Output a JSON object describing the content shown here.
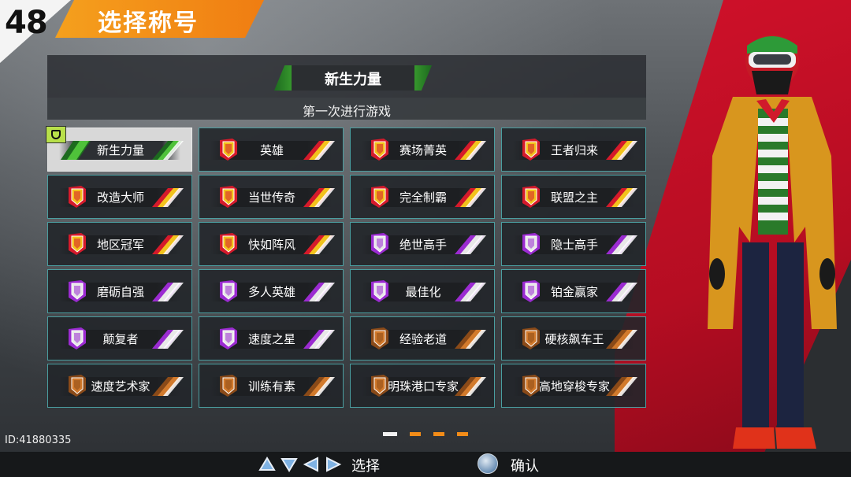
{
  "header": {
    "level": "48",
    "title": "选择称号"
  },
  "selected_title": {
    "name": "新生力量",
    "description": "第一次进行游戏"
  },
  "titles": [
    {
      "label": "新生力量",
      "tier": "green",
      "selected": true
    },
    {
      "label": "英雄",
      "tier": "gold-red"
    },
    {
      "label": "赛场菁英",
      "tier": "gold-red"
    },
    {
      "label": "王者归来",
      "tier": "gold-red"
    },
    {
      "label": "改造大师",
      "tier": "gold-red"
    },
    {
      "label": "当世传奇",
      "tier": "gold-red"
    },
    {
      "label": "完全制霸",
      "tier": "gold-red"
    },
    {
      "label": "联盟之主",
      "tier": "gold-red"
    },
    {
      "label": "地区冠军",
      "tier": "gold-red"
    },
    {
      "label": "快如阵风",
      "tier": "gold-red"
    },
    {
      "label": "绝世高手",
      "tier": "purple"
    },
    {
      "label": "隐士高手",
      "tier": "purple"
    },
    {
      "label": "磨砺自强",
      "tier": "purple"
    },
    {
      "label": "多人英雄",
      "tier": "purple"
    },
    {
      "label": "最佳化",
      "tier": "purple"
    },
    {
      "label": "铂金赢家",
      "tier": "purple"
    },
    {
      "label": "颠复者",
      "tier": "purple"
    },
    {
      "label": "速度之星",
      "tier": "purple"
    },
    {
      "label": "经验老道",
      "tier": "bronze"
    },
    {
      "label": "硬核飙车王",
      "tier": "bronze"
    },
    {
      "label": "速度艺术家",
      "tier": "bronze"
    },
    {
      "label": "训练有素",
      "tier": "bronze"
    },
    {
      "label": "明珠港口专家",
      "tier": "bronze"
    },
    {
      "label": "高地穿梭专家",
      "tier": "bronze"
    }
  ],
  "pagination": {
    "pages": 4,
    "current": 1
  },
  "player_id": "ID:41880335",
  "footer": {
    "select_label": "选择",
    "confirm_label": "确认"
  },
  "colors": {
    "accent_orange": "#f28c18",
    "tile_border": "#4a9ea0",
    "green": "#4fc23a",
    "gold": "#f2c21c",
    "red": "#d51a2b",
    "purple": "#9b2bd1",
    "bronze": "#d27a2c"
  }
}
